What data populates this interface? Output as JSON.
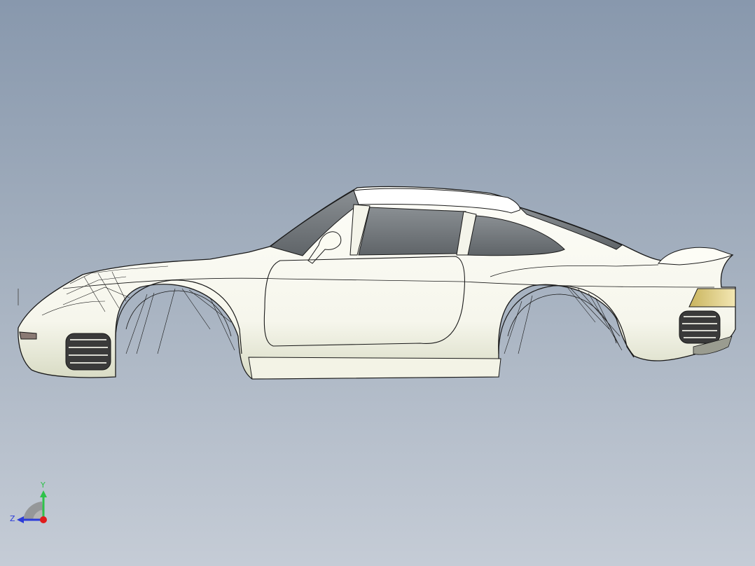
{
  "triad": {
    "y_label": "Y",
    "z_label": "Z",
    "y_color": "#2ec24a",
    "z_color": "#2b3bd9",
    "x_color": "#e01b1b"
  },
  "colors": {
    "background_top": "#8898ad",
    "background_bottom": "#c5ccd6",
    "body_fill": "#fbfbf4",
    "body_shadow": "#d9dcc6",
    "glass": "#6f7478",
    "edge": "#1a1a1a",
    "taillight": "#e6d28a"
  },
  "icons": [
    "car-body-model",
    "coordinate-triad-icon"
  ]
}
